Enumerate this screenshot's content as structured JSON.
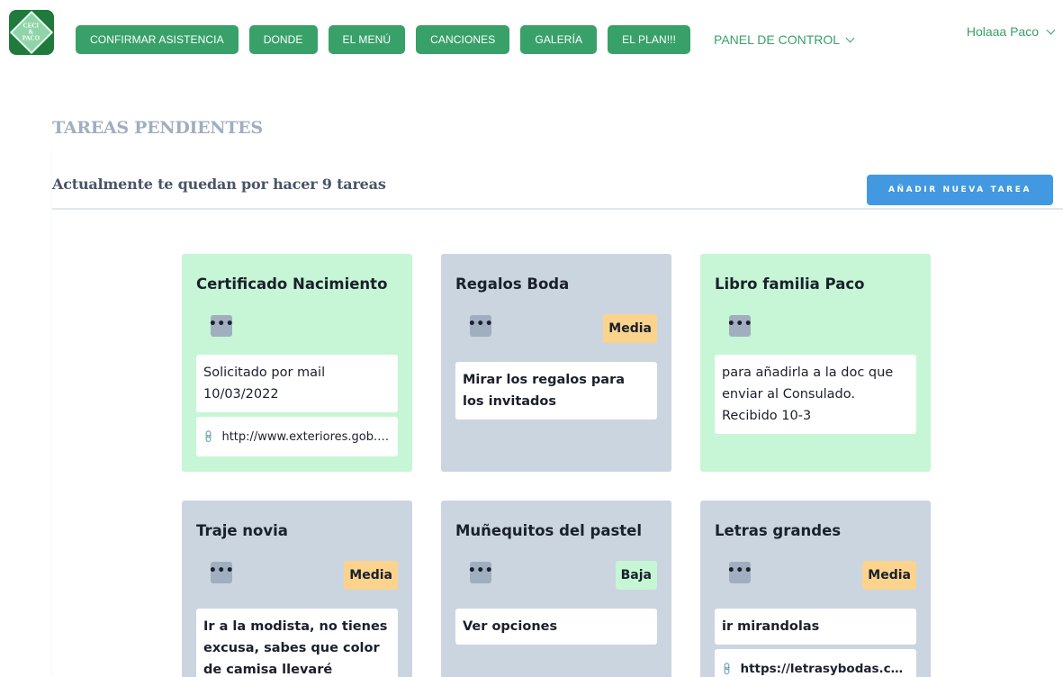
{
  "logo": {
    "text": "CECI\n&\nPACO"
  },
  "nav": {
    "buttons": [
      "CONFIRMAR ASISTENCIA",
      "DONDE",
      "EL MENÚ",
      "CANCIONES",
      "GALERÍA",
      "EL PLAN!!!"
    ],
    "dropdown": "PANEL DE CONTROL"
  },
  "user": {
    "greeting": "Holaaa Paco"
  },
  "main": {
    "title": "TAREAS PENDIENTES",
    "subtitle": "Actualmente te quedan por hacer 9 tareas",
    "add_button": "AÑADIR NUEVA TAREA"
  },
  "cards": [
    {
      "title": "Certificado Nacimiento",
      "color": "#c6f6d5",
      "badge": "",
      "text": "Solicitado por mail 10/03/2022",
      "link": "http://www.exteriores.gob.es..."
    },
    {
      "title": "Regalos Boda",
      "color": "#cbd5e0",
      "badge": "Media",
      "text": "Mirar los regalos para los invitados",
      "link": ""
    },
    {
      "title": "Libro familia Paco",
      "color": "#c6f6d5",
      "badge": "",
      "text": "para añadirla a la doc que enviar al Consulado. Recibido 10-3",
      "link": ""
    },
    {
      "title": "Traje novia",
      "color": "#cbd5e0",
      "badge": "Media",
      "text": "Ir a la modista, no tienes excusa, sabes que color de camisa llevaré",
      "link": ""
    },
    {
      "title": "Muñequitos del pastel",
      "color": "#cbd5e0",
      "badge": "Baja",
      "text": "Ver opciones",
      "link": ""
    },
    {
      "title": "Letras grandes",
      "color": "#cbd5e0",
      "badge": "Media",
      "text": "ir mirandolas",
      "link": "https://letrasybodas.com/l..."
    }
  ],
  "icons": {
    "dots": "ellipsis-icon",
    "link": "paperclip-icon",
    "chevron": "chevron-down-icon"
  },
  "colors": {
    "primary": "#38a169",
    "accent": "#4299e1",
    "title_grey": "#a0aec0"
  }
}
